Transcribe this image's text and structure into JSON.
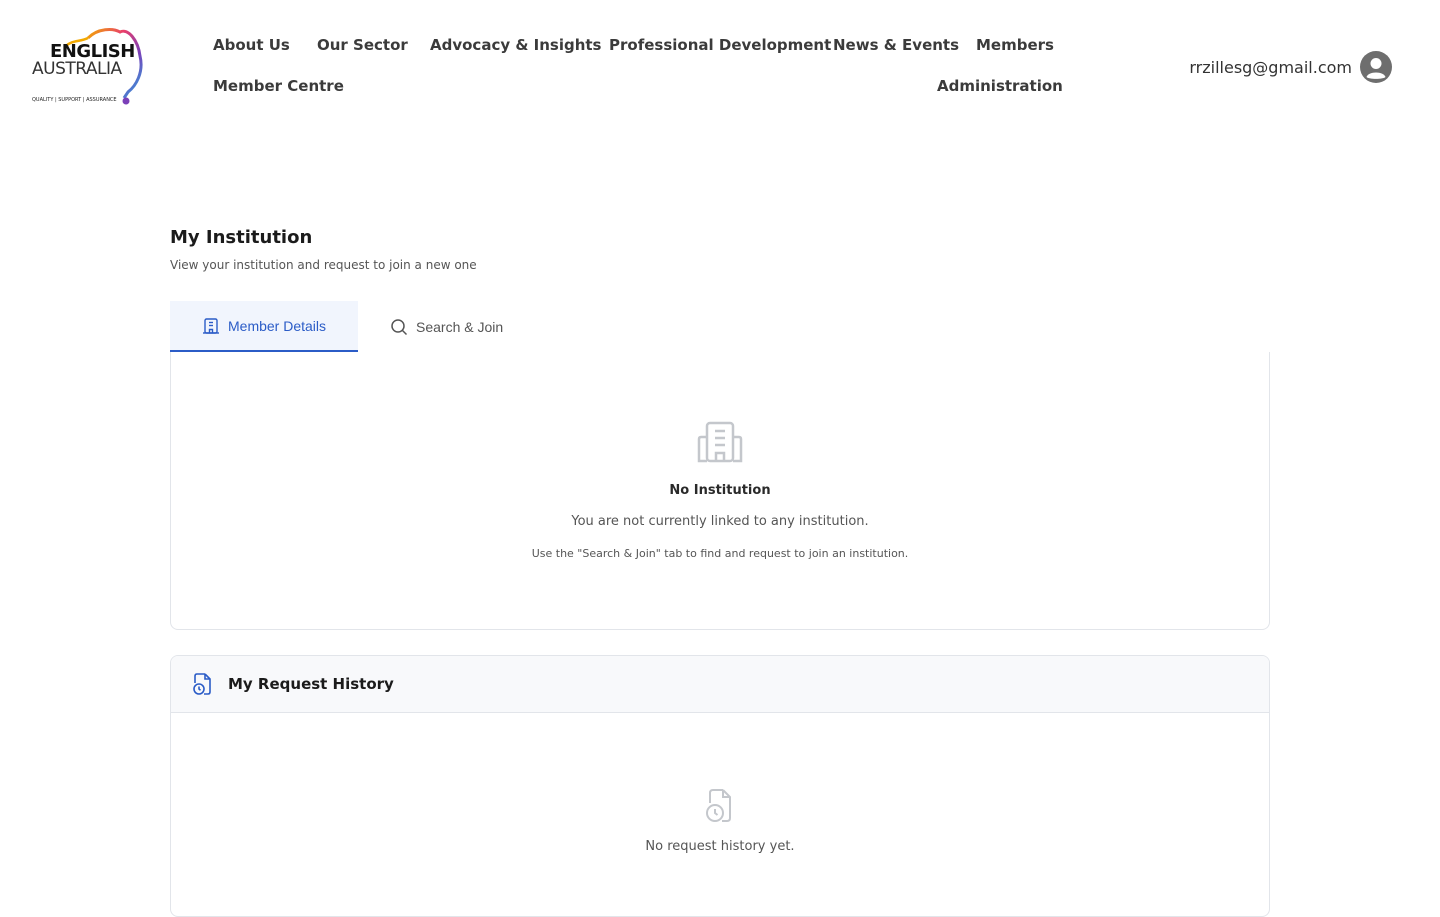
{
  "logo": {
    "line1": "ENGLISH",
    "line2": "AUSTRALIA",
    "tagline": "QUALITY | SUPPORT | ASSURANCE"
  },
  "nav": {
    "about": "About Us",
    "sector": "Our Sector",
    "advocacy": "Advocacy & Insights",
    "profdev": "Professional Development",
    "news": "News & Events",
    "members": "Members",
    "member_centre": "Member Centre",
    "administration": "Administration"
  },
  "user": {
    "email": "rrzillesg@gmail.com",
    "avatar_icon": "user-circle-icon"
  },
  "page": {
    "title": "My Institution",
    "subtitle": "View your institution and request to join a new one"
  },
  "tabs": {
    "member_details": "Member Details",
    "search_join": "Search & Join"
  },
  "institution": {
    "empty_title": "No Institution",
    "empty_text": "You are not currently linked to any institution.",
    "empty_hint": "Use the \"Search & Join\" tab to find and request to join an institution."
  },
  "history": {
    "title": "My Request History",
    "empty_text": "No request history yet."
  },
  "colors": {
    "accent": "#2b5cc7",
    "text": "#3b3b3b",
    "border": "#e2e5ea"
  }
}
